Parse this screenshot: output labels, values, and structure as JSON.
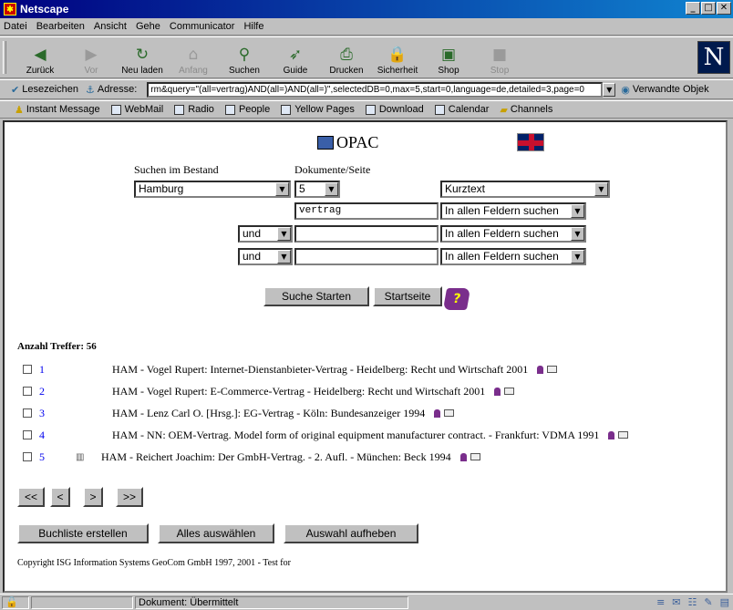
{
  "window": {
    "title": "Netscape"
  },
  "menu": [
    "Datei",
    "Bearbeiten",
    "Ansicht",
    "Gehe",
    "Communicator",
    "Hilfe"
  ],
  "toolbar": [
    {
      "label": "Zurück",
      "icon": "back-arrow-icon",
      "glyph": "◀",
      "enabled": true
    },
    {
      "label": "Vor",
      "icon": "forward-arrow-icon",
      "glyph": "▶",
      "enabled": false
    },
    {
      "label": "Neu laden",
      "icon": "reload-icon",
      "glyph": "↻",
      "enabled": true
    },
    {
      "label": "Anfang",
      "icon": "home-icon",
      "glyph": "⌂",
      "enabled": false
    },
    {
      "label": "Suchen",
      "icon": "search-icon",
      "glyph": "⚲",
      "enabled": true
    },
    {
      "label": "Guide",
      "icon": "guide-icon",
      "glyph": "➶",
      "enabled": true
    },
    {
      "label": "Drucken",
      "icon": "print-icon",
      "glyph": "⎙",
      "enabled": true
    },
    {
      "label": "Sicherheit",
      "icon": "security-lock-icon",
      "glyph": "🔒",
      "enabled": true
    },
    {
      "label": "Shop",
      "icon": "shop-icon",
      "glyph": "▣",
      "enabled": true
    },
    {
      "label": "Stop",
      "icon": "stop-icon",
      "glyph": "■",
      "enabled": false
    }
  ],
  "location": {
    "bookmarks_label": "Lesezeichen",
    "address_label": "Adresse:",
    "url": "rm&query=\"(all=vertrag)AND(all=)AND(all=)\",selectedDB=0,max=5,start=0,language=de,detailed=3,page=0",
    "related_label": "Verwandte Objek"
  },
  "personal_toolbar": [
    "Instant Message",
    "WebMail",
    "Radio",
    "People",
    "Yellow Pages",
    "Download",
    "Calendar",
    "Channels"
  ],
  "page": {
    "title": "OPAC",
    "label_bestand": "Suchen im Bestand",
    "label_docs": "Dokumente/Seite",
    "bestand_value": "Hamburg",
    "docs_value": "5",
    "format_value": "Kurztext",
    "query1": "vertrag",
    "query2": "",
    "query3": "",
    "field1": "In allen Feldern suchen",
    "field2": "In allen Feldern suchen",
    "field3": "In allen Feldern suchen",
    "op2": "und",
    "op3": "und",
    "search_button": "Suche Starten",
    "home_button": "Startseite",
    "help_icon_glyph": "?",
    "hits_label": "Anzahl Treffer: 56",
    "results": [
      {
        "num": "1",
        "text": "HAM - Vogel Rupert: Internet-Dienstanbieter-Vertrag - Heidelberg: Recht und Wirtschaft 2001",
        "book": false
      },
      {
        "num": "2",
        "text": "HAM - Vogel Rupert: E-Commerce-Vertrag - Heidelberg: Recht und Wirtschaft 2001",
        "book": false
      },
      {
        "num": "3",
        "text": "HAM - Lenz Carl O. [Hrsg.]: EG-Vertrag - Köln: Bundesanzeiger 1994",
        "book": false
      },
      {
        "num": "4",
        "text": "HAM - NN: OEM-Vertrag. Model form of original equipment manufacturer contract. - Frankfurt: VDMA 1991",
        "book": false
      },
      {
        "num": "5",
        "text": "HAM - Reichert Joachim: Der GmbH-Vertrag. - 2. Aufl. - München: Beck 1994",
        "book": true
      }
    ],
    "nav": [
      "<<",
      "<",
      ">",
      ">>"
    ],
    "list_button": "Buchliste erstellen",
    "select_all_button": "Alles auswählen",
    "deselect_button": "Auswahl aufheben",
    "copyright": "Copyright ISG Information Systems GeoCom GmbH 1997, 2001 - Test for"
  },
  "status": {
    "text": "Dokument: Übermittelt"
  }
}
